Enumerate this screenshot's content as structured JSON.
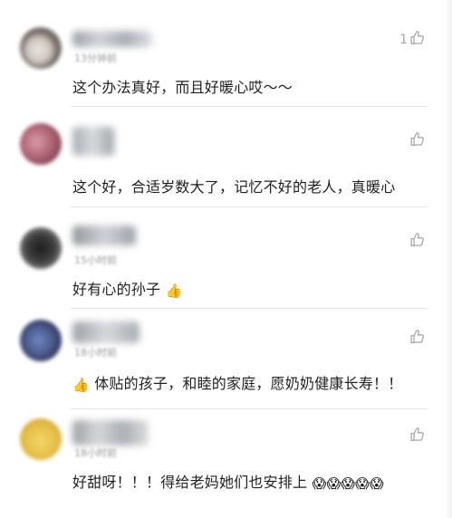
{
  "comments": [
    {
      "time": "13分钟前",
      "like_count": "1",
      "text": "这个办法真好，而且好暖心哎～～",
      "emoji_prefix": "",
      "emoji_suffix": ""
    },
    {
      "time": "",
      "like_count": "",
      "text": "这个好，合适岁数大了，记忆不好的老人，真暖心",
      "emoji_prefix": "",
      "emoji_suffix": ""
    },
    {
      "time": "15小时前",
      "like_count": "",
      "text": "好有心的孙子",
      "emoji_prefix": "",
      "emoji_suffix": "👍"
    },
    {
      "time": "18小时前",
      "like_count": "",
      "text": "体贴的孩子，和睦的家庭，愿奶奶健康长寿！！",
      "emoji_prefix": "👍",
      "emoji_suffix": ""
    },
    {
      "time": "18小时前",
      "like_count": "",
      "text": "好甜呀！！！得给老妈她们也安排上",
      "emoji_prefix": "",
      "emoji_suffix": "😱😱😱😱😱"
    }
  ],
  "icons": {
    "like": "thumbs-up-outline-icon",
    "avatar_colors": [
      "#b9b3ad",
      "#b56b7a",
      "#3d3d3d",
      "#4a5a8a",
      "#e8c24a"
    ],
    "like_color": "#a8a8a8",
    "text_color": "#1f1f1f",
    "meta_color": "#9a9a9a"
  }
}
